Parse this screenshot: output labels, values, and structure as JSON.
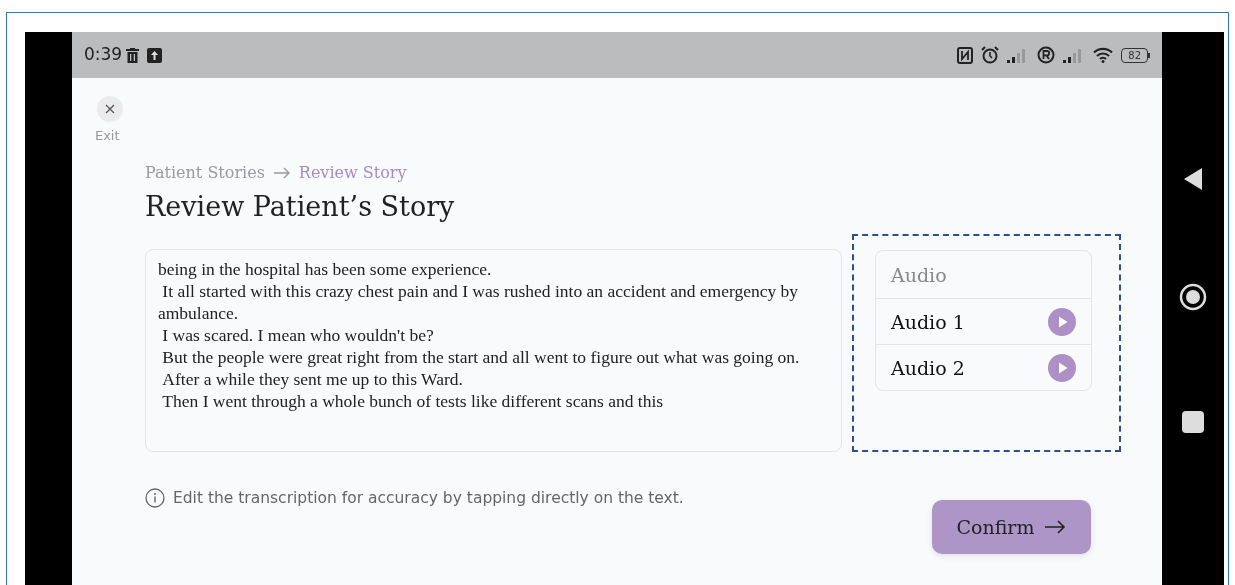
{
  "status_bar": {
    "time": "0:39",
    "battery": "82"
  },
  "exit": {
    "label": "Exit"
  },
  "breadcrumb": [
    {
      "label": "Patient Stories",
      "selected": false
    },
    {
      "label": "Review Story",
      "selected": true
    }
  ],
  "title": "Review Patient’s Story",
  "transcript": {
    "lines": [
      "being in the hospital has been some experience.",
      " It all started with this crazy chest pain and I was rushed into an accident and emergency by ambulance.",
      " I was scared. I mean who wouldn't be?",
      " But the people were great right from the start and all went to figure out what was going on.",
      " After a while they sent me up to this Ward.",
      " Then I went through a whole bunch of tests like different scans and this"
    ]
  },
  "audio_panel": {
    "highlighted": true,
    "header": "Audio",
    "items": [
      {
        "label": "Audio 1"
      },
      {
        "label": "Audio 2"
      }
    ]
  },
  "hint": "Edit the transcription for accuracy by tapping directly on the text.",
  "confirm_button": {
    "label": "Confirm"
  }
}
